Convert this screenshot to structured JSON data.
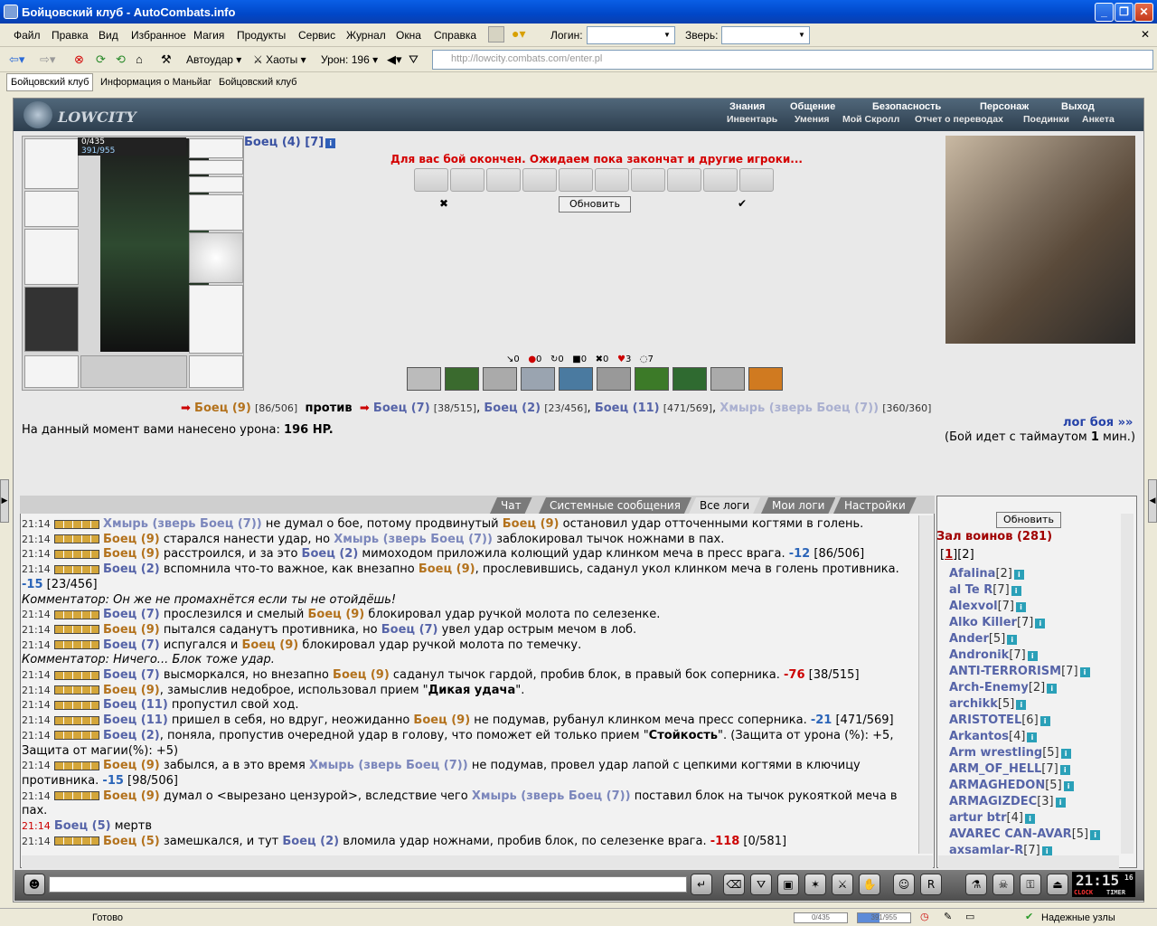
{
  "window": {
    "title": "Бойцовский клуб - AutoCombats.info"
  },
  "menu": [
    "Файл",
    "Правка",
    "Вид",
    "Избранное",
    "Магия",
    "Продукты",
    "Сервис",
    "Журнал",
    "Окна",
    "Справка"
  ],
  "login_label": "Логин:",
  "beast_label": "Зверь:",
  "toolbar": {
    "autoudar": "Автоудар",
    "haoty": "Хаоты",
    "uron": "Урон: 196"
  },
  "address": "http://lowcity.combats.com/enter.pl",
  "tabs": [
    "Бойцовский клуб",
    "Информация о Маньйаг",
    "Бойцовский клуб"
  ],
  "logo": "LOWCITY",
  "nav_top": [
    "Знания",
    "Общение",
    "Безопасность",
    "Персонаж",
    "Выход"
  ],
  "nav_bottom": [
    "Инвентарь",
    "Умения",
    "Мой Скролл",
    "Отчет о переводах",
    "Поединки",
    "Анкета"
  ],
  "hp": {
    "hp": "0/435",
    "mana": "391/955"
  },
  "fighter": {
    "name": "Боец (4) [7]",
    "info_icon": "info-icon"
  },
  "battle_message": "Для вас бой окончен. Ожидаем пока закончат и другие игроки...",
  "refresh_label": "Обновить",
  "stats": [
    "0",
    "0",
    "0",
    "0",
    "0",
    "3",
    "7"
  ],
  "versus": {
    "left": {
      "name": "Боец (9)",
      "hp": "[86/506]"
    },
    "vs": "против",
    "right": [
      {
        "name": "Боец (7)",
        "hp": "[38/515]"
      },
      {
        "name": "Боец (2)",
        "hp": "[23/456]"
      },
      {
        "name": "Боец (11)",
        "hp": "[471/569]"
      },
      {
        "name": "Хмырь (зверь Боец (7))",
        "hp": "[360/360]"
      }
    ]
  },
  "damage_label": "На данный момент вами нанесено урона:",
  "damage_value": "196 HP.",
  "log_link": "лог боя »»",
  "timeout_text_a": "(Бой идет с таймаутом ",
  "timeout_value": "1",
  "timeout_text_b": " мин.)",
  "chat_tabs": [
    "Чат",
    "Системные сообщения",
    "Все логи",
    "Мои логи",
    "Настройки"
  ],
  "log": [
    {
      "t": "21:14",
      "html": "<span class='purp'>Хмырь (зверь Боец (7))</span> не думал о бое, потому продвинутый <span class='orng'>Боец (9)</span> остановил удар отточенными когтями в голень."
    },
    {
      "t": "21:14",
      "html": "<span class='orng'>Боец (9)</span> старался нанести удар, но <span class='purp'>Хмырь (зверь Боец (7))</span> заблокировал тычок ножнами в пах."
    },
    {
      "t": "21:14",
      "html": "<span class='orng'>Боец (9)</span> расстроился, и за это <span class='blue'>Боец (2)</span> мимоходом приложила колющий удар клинком меча в пресс врага. <span class='dmgb'>-12</span> [86/506]"
    },
    {
      "t": "21:14",
      "html": "<span class='blue'>Боец (2)</span> вспомнила что-то важное, как внезапно <span class='orng'>Боец (9)</span>, прослевившись, саданул укол клинком меча в голень противника. <span class='dmgb'>-15</span> [23/456]"
    },
    {
      "t": "",
      "html": "<span class='comm'>Комментатор: Он же не промахнётся если ты не отойдёшь!</span>"
    },
    {
      "t": "21:14",
      "html": "<span class='blue'>Боец (7)</span> прослезился и смелый <span class='orng'>Боец (9)</span> блокировал удар ручкой молота по селезенке."
    },
    {
      "t": "21:14",
      "html": "<span class='orng'>Боец (9)</span> пытался саданутъ противника, но <span class='blue'>Боец (7)</span> увел удар острым мечом в лоб."
    },
    {
      "t": "21:14",
      "html": "<span class='blue'>Боец (7)</span> испугался и <span class='orng'>Боец (9)</span> блокировал удар ручкой молота по темечку."
    },
    {
      "t": "",
      "html": "<span class='comm'>Комментатор: Ничего... Блок тоже удар.</span>"
    },
    {
      "t": "21:14",
      "html": "<span class='blue'>Боец (7)</span> высморкался, но внезапно <span class='orng'>Боец (9)</span> саданул тычок гардой, пробив блок, в правый бок соперника. <span class='dmg'>-76</span> [38/515]"
    },
    {
      "t": "21:14",
      "html": "<span class='orng'>Боец (9)</span>, замыслив недоброе, использовал прием \"<b>Дикая удача</b>\"."
    },
    {
      "t": "21:14",
      "html": "<span class='blue'>Боец (11)</span> пропустил свой ход."
    },
    {
      "t": "21:14",
      "html": "<span class='blue'>Боец (11)</span> пришел в себя, но вдруг, неожиданно <span class='orng'>Боец (9)</span> не подумав, рубанул клинком меча пресс соперника. <span class='dmgb'>-21</span> [471/569]"
    },
    {
      "t": "21:14",
      "html": "<span class='blue'>Боец (2)</span>, поняла, пропустив очередной удар в голову, что поможет ей только прием \"<b>Стойкость</b>\". (Защита от урона (%): +5, Защита от магии(%): +5)"
    },
    {
      "t": "21:14",
      "html": "<span class='orng'>Боец (9)</span> забылся, а в это время <span class='purp'>Хмырь (зверь Боец (7))</span> не подумав, провел удар лапой с цепкими когтями в ключицу противника. <span class='dmgb'>-15</span> [98/506]"
    },
    {
      "t": "21:14",
      "html": "<span class='orng'>Боец (9)</span> думал о &lt;вырезано цензурой&gt;, вследствие чего <span class='purp'>Хмырь (зверь Боец (7))</span> поставил блок на тычок рукояткой меча в пах."
    },
    {
      "t": "21:14",
      "red": true,
      "html": "<span class='blue'>Боец (5)</span> мертв"
    },
    {
      "t": "21:14",
      "html": "<span class='orng'>Боец (5)</span> замешкался, и тут <span class='blue'>Боец (2)</span> вломила удар ножнами, пробив блок, по селезенке врага. <span class='dmg'>-118</span> [0/581]"
    }
  ],
  "hall": {
    "title": "Зал воинов (281)",
    "pages": [
      "1",
      "2"
    ]
  },
  "players": [
    {
      "name": "Afalina",
      "lvl": "[2]"
    },
    {
      "name": "al Te R",
      "lvl": "[7]"
    },
    {
      "name": "Alexvol",
      "lvl": "[7]"
    },
    {
      "name": "Alko Killer",
      "lvl": "[7]"
    },
    {
      "name": "Ander",
      "lvl": "[5]"
    },
    {
      "name": "Andronik",
      "lvl": "[7]"
    },
    {
      "name": "ANTI-TERRORISM",
      "lvl": "[7]"
    },
    {
      "name": "Arch-Enemy",
      "lvl": "[2]"
    },
    {
      "name": "archikk",
      "lvl": "[5]"
    },
    {
      "name": "ARISTOTEL",
      "lvl": "[6]"
    },
    {
      "name": "Arkantos",
      "lvl": "[4]"
    },
    {
      "name": "Arm wrestling",
      "lvl": "[5]"
    },
    {
      "name": "ARM_OF_HELL",
      "lvl": "[7]"
    },
    {
      "name": "ARMAGHEDON",
      "lvl": "[5]"
    },
    {
      "name": "ARMAGIZDEC",
      "lvl": "[3]"
    },
    {
      "name": "artur btr",
      "lvl": "[4]"
    },
    {
      "name": "AVAREC CAN-AVAR",
      "lvl": "[5]"
    },
    {
      "name": "axsamlar-R",
      "lvl": "[7]"
    }
  ],
  "clock": {
    "time": "21:15",
    "sec": "16",
    "clock_label": "CLOCK",
    "timer_label": "TIMER"
  },
  "status": {
    "ready": "Готово",
    "bar1": "0/435",
    "bar2": "391/955",
    "zone": "Надежные узлы"
  }
}
